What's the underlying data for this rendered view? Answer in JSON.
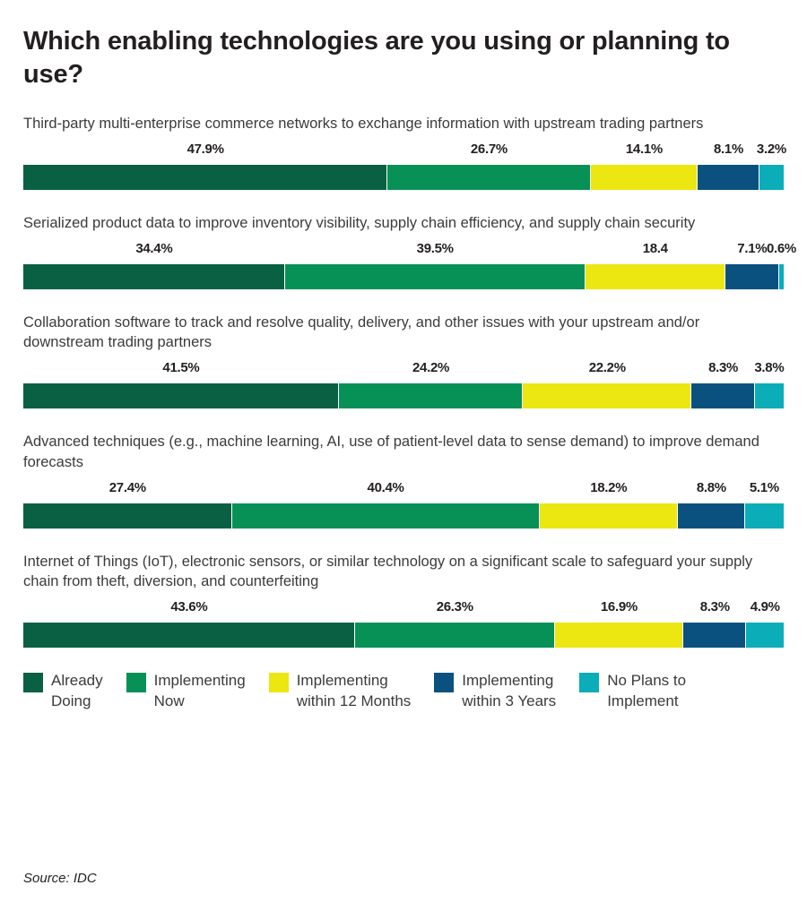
{
  "title": "Which enabling technologies are you using or planning to use?",
  "source": "Source: IDC",
  "colors": {
    "already_doing": "#0a6043",
    "implementing_now": "#089157",
    "within_12_months": "#ece711",
    "within_3_years": "#0a5180",
    "no_plans": "#0aadb8"
  },
  "legend": [
    {
      "label": "Already\nDoing",
      "color": "#0a6043"
    },
    {
      "label": "Implementing\nNow",
      "color": "#089157"
    },
    {
      "label": "Implementing\nwithin 12 Months",
      "color": "#ece711"
    },
    {
      "label": "Implementing\nwithin 3 Years",
      "color": "#0a5180"
    },
    {
      "label": "No Plans to\nImplement",
      "color": "#0aadb8"
    }
  ],
  "chart_data": {
    "type": "bar",
    "title": "Which enabling technologies are you using or planning to use?",
    "subtype": "100% stacked horizontal bar",
    "xlabel": "",
    "ylabel": "",
    "xlim": [
      0,
      100
    ],
    "grid": false,
    "legend_position": "bottom",
    "units": "percent",
    "categories": [
      "Third-party multi-enterprise commerce networks to exchange information with upstream trading partners",
      "Serialized product data to improve inventory visibility, supply chain efficiency, and supply chain security",
      "Collaboration software to track and resolve quality, delivery, and other issues with your upstream and/or downstream trading partners",
      "Advanced techniques (e.g., machine learning, AI, use of patient-level data to sense demand) to improve demand forecasts",
      "Internet of Things (IoT), electronic sensors, or similar technology on a significant scale to safeguard your supply chain from theft, diversion, and counterfeiting"
    ],
    "series": [
      {
        "name": "Already Doing",
        "color": "#0a6043",
        "values": [
          47.9,
          34.4,
          41.5,
          27.4,
          43.6
        ]
      },
      {
        "name": "Implementing Now",
        "color": "#089157",
        "values": [
          26.7,
          39.5,
          24.2,
          40.4,
          26.3
        ]
      },
      {
        "name": "Implementing within 12 Months",
        "color": "#ece711",
        "values": [
          14.1,
          18.4,
          22.2,
          18.2,
          16.9
        ]
      },
      {
        "name": "Implementing within 3 Years",
        "color": "#0a5180",
        "values": [
          8.1,
          7.1,
          8.3,
          8.8,
          8.3
        ]
      },
      {
        "name": "No Plans to Implement",
        "color": "#0aadb8",
        "values": [
          3.2,
          0.6,
          3.8,
          5.1,
          4.9
        ]
      }
    ]
  },
  "bars": [
    {
      "label": "Third-party multi-enterprise commerce networks to exchange information with upstream trading partners",
      "segments": [
        {
          "value": 47.9,
          "text": "47.9%",
          "color": "#0a6043"
        },
        {
          "value": 26.7,
          "text": "26.7%",
          "color": "#089157"
        },
        {
          "value": 14.1,
          "text": "14.1%",
          "color": "#ece711"
        },
        {
          "value": 8.1,
          "text": "8.1%",
          "color": "#0a5180"
        },
        {
          "value": 3.2,
          "text": "3.2%",
          "color": "#0aadb8"
        }
      ]
    },
    {
      "label": "Serialized product data to improve inventory visibility, supply chain efficiency, and supply chain security",
      "segments": [
        {
          "value": 34.4,
          "text": "34.4%",
          "color": "#0a6043"
        },
        {
          "value": 39.5,
          "text": "39.5%",
          "color": "#089157"
        },
        {
          "value": 18.4,
          "text": "18.4",
          "color": "#ece711"
        },
        {
          "value": 7.1,
          "text": "7.1%",
          "color": "#0a5180"
        },
        {
          "value": 0.6,
          "text": "0.6%",
          "color": "#0aadb8"
        }
      ]
    },
    {
      "label": "Collaboration software to track and resolve quality, delivery, and other issues with your upstream and/or downstream trading partners",
      "segments": [
        {
          "value": 41.5,
          "text": "41.5%",
          "color": "#0a6043"
        },
        {
          "value": 24.2,
          "text": "24.2%",
          "color": "#089157"
        },
        {
          "value": 22.2,
          "text": "22.2%",
          "color": "#ece711"
        },
        {
          "value": 8.3,
          "text": "8.3%",
          "color": "#0a5180"
        },
        {
          "value": 3.8,
          "text": "3.8%",
          "color": "#0aadb8"
        }
      ]
    },
    {
      "label": "Advanced techniques (e.g., machine learning, AI, use of patient-level data to sense demand) to improve demand forecasts",
      "segments": [
        {
          "value": 27.4,
          "text": "27.4%",
          "color": "#0a6043"
        },
        {
          "value": 40.4,
          "text": "40.4%",
          "color": "#089157"
        },
        {
          "value": 18.2,
          "text": "18.2%",
          "color": "#ece711"
        },
        {
          "value": 8.8,
          "text": "8.8%",
          "color": "#0a5180"
        },
        {
          "value": 5.1,
          "text": "5.1%",
          "color": "#0aadb8"
        }
      ]
    },
    {
      "label": "Internet of Things (IoT), electronic sensors, or similar technology on a significant scale to safeguard your supply chain from theft, diversion, and counterfeiting",
      "segments": [
        {
          "value": 43.6,
          "text": "43.6%",
          "color": "#0a6043"
        },
        {
          "value": 26.3,
          "text": "26.3%",
          "color": "#089157"
        },
        {
          "value": 16.9,
          "text": "16.9%",
          "color": "#ece711"
        },
        {
          "value": 8.3,
          "text": "8.3%",
          "color": "#0a5180"
        },
        {
          "value": 4.9,
          "text": "4.9%",
          "color": "#0aadb8"
        }
      ]
    }
  ]
}
